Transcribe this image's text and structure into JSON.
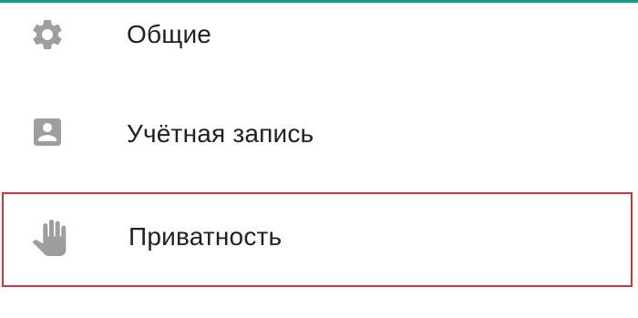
{
  "settings": {
    "accent_color": "#0f9d8f",
    "highlight_color": "#d0343c",
    "items": [
      {
        "label": "Общие",
        "icon": "gear-icon"
      },
      {
        "label": "Учётная запись",
        "icon": "account-icon"
      },
      {
        "label": "Приватность",
        "icon": "hand-icon",
        "highlighted": true
      }
    ]
  }
}
